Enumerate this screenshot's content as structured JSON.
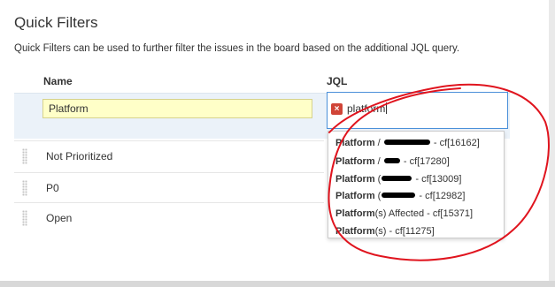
{
  "header": {
    "title": "Quick Filters",
    "description": "Quick Filters can be used to further filter the issues in the board based on the additional JQL query."
  },
  "columns": {
    "name": "Name",
    "jql": "JQL"
  },
  "editor": {
    "name_value": "Platform",
    "jql_value": "platform"
  },
  "filters": [
    {
      "label": "Not Prioritized"
    },
    {
      "label": "P0"
    },
    {
      "label": "Open"
    }
  ],
  "suggestions": [
    {
      "bold": "Platform",
      "mid": " / ",
      "tail": " - cf[16162]"
    },
    {
      "bold": "Platform",
      "mid": " / ",
      "tail": " - cf[17280]"
    },
    {
      "bold": "Platform",
      "mid": " (",
      "tail": " - cf[13009]"
    },
    {
      "bold": "Platform",
      "mid": " (",
      "tail": " - cf[12982]"
    },
    {
      "bold": "Platform",
      "mid": "",
      "tail": "(s) Affected - cf[15371]"
    },
    {
      "bold": "Platform",
      "mid": "",
      "tail": "(s) - cf[11275]"
    }
  ],
  "colors": {
    "annotation": "#e0141e",
    "error": "#d04437",
    "focus": "#4a90d9"
  }
}
